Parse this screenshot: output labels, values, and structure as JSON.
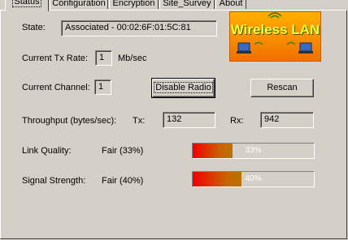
{
  "tabs": [
    "Status",
    "Configuration",
    "Encryption",
    "Site_Survey",
    "About"
  ],
  "active_tab": "Status",
  "logo": {
    "text": "Wireless LAN"
  },
  "state": {
    "label": "State:",
    "value": "Associated - 00:02:6F:01:5C:81"
  },
  "tx_rate": {
    "label": "Current Tx Rate:",
    "value": "1",
    "unit": "Mb/sec"
  },
  "channel": {
    "label": "Current Channel:",
    "value": "1"
  },
  "buttons": {
    "disable_radio": "Disable Radio",
    "rescan": "Rescan"
  },
  "throughput": {
    "label": "Throughput (bytes/sec):",
    "tx_label": "Tx:",
    "tx_value": "132",
    "rx_label": "Rx:",
    "rx_value": "942"
  },
  "link_quality": {
    "label": "Link Quality:",
    "text": "Fair (33%)",
    "percent_label": "33%",
    "percent": 33
  },
  "signal_strength": {
    "label": "Signal Strength:",
    "text": "Fair (40%)",
    "percent_label": "40%",
    "percent": 40
  }
}
